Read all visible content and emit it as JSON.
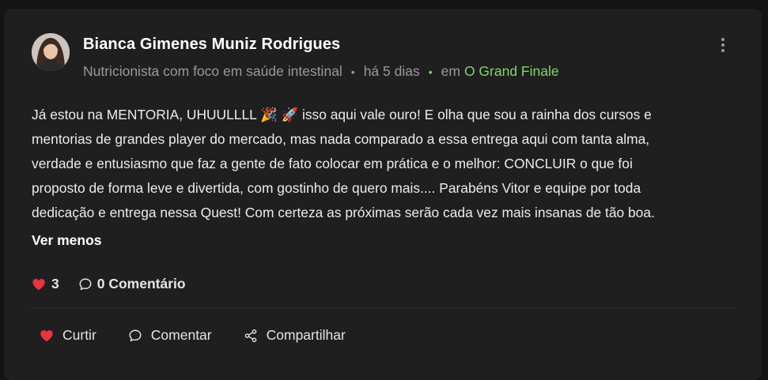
{
  "post": {
    "author": {
      "name": "Bianca Gimenes Muniz Rodrigues",
      "headline": "Nutricionista com foco em saúde intestinal"
    },
    "time_ago": "há 5 dias",
    "group_prefix": "em",
    "group_name": "O Grand Finale",
    "body_lines": [
      "Já estou na MENTORIA, UHUULLLL 🎉 🚀 isso aqui vale ouro! E olha que sou a rainha dos cursos e",
      "mentorias de grandes player do mercado, mas nada comparado a essa entrega aqui com tanta alma,",
      "verdade e entusiasmo que faz a gente de fato colocar em prática e o melhor: CONCLUIR o que foi",
      "proposto de forma leve e divertida, com gostinho de quero mais.... Parabéns Vitor e equipe por toda",
      "dedicação e entrega nessa Quest! Com certeza as próximas serão cada vez mais insanas de tão boa."
    ],
    "see_less_label": "Ver menos",
    "like_count": "3",
    "comment_count_label": "0 Comentário"
  },
  "actions": {
    "like_label": "Curtir",
    "comment_label": "Comentar",
    "share_label": "Compartilhar"
  },
  "colors": {
    "card_bg": "#1f1f1f",
    "page_bg": "#141414",
    "accent_green": "#7fd96a",
    "heart_red": "#e8343f",
    "muted_text": "#9a9a9a"
  },
  "icons": {
    "menu": "kebab-menu-icon",
    "like_stat": "heart-icon",
    "comment_stat": "speech-bubble-icon",
    "like_action": "heart-icon",
    "comment_action": "speech-bubble-icon",
    "share_action": "share-icon"
  }
}
